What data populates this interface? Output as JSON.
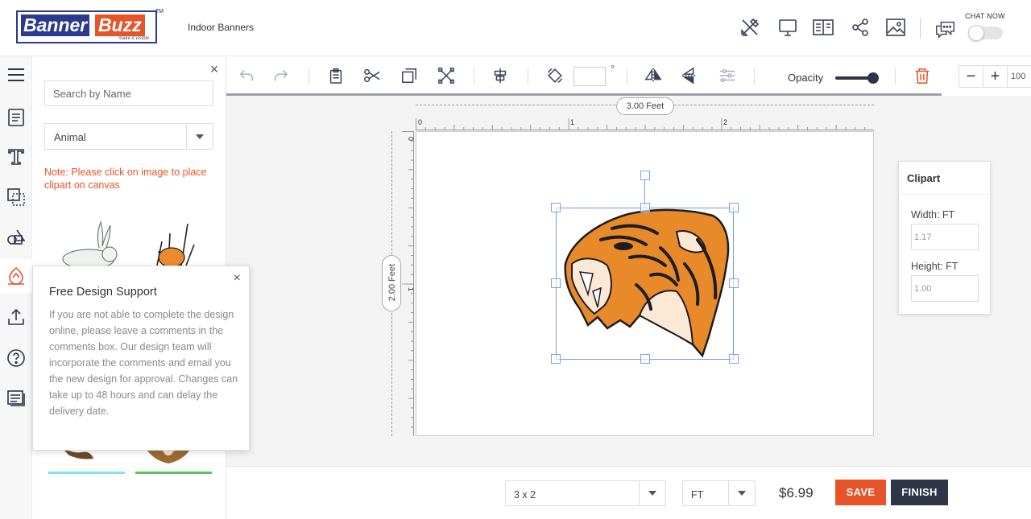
{
  "brand": {
    "logo_part1": "Banner",
    "logo_part2": "Buzz",
    "tagline": "make it visible",
    "trademark": "TM",
    "colors": {
      "navy": "#2a3a8c",
      "orange": "#e8542a",
      "dark": "#2d3547"
    }
  },
  "header": {
    "product_name": "Indoor Banners",
    "icons": [
      "design-tools-icon",
      "monitor-icon",
      "book-icon",
      "share-icon",
      "image-icon",
      "chat-icon"
    ],
    "chat_label": "CHAT NOW",
    "chat_toggle_on": false
  },
  "rail": {
    "items": [
      "menu-icon",
      "template-icon",
      "text-icon",
      "layers-icon",
      "shapes-icon",
      "clipart-icon",
      "upload-icon",
      "help-icon",
      "notes-icon"
    ],
    "active": "clipart-icon"
  },
  "panel": {
    "close": "×",
    "search_placeholder": "Search by Name",
    "category": "Animal",
    "note": "Note: Please click on image to place clipart on canvas"
  },
  "support": {
    "title": "Free Design Support",
    "close": "×",
    "body": "If you are not able to complete the design online, please leave a comments in the comments box. Our design team will incorporate the comments and email you the new design for approval. Changes can take up to 48 hours and can delay the delivery date."
  },
  "toolbar": {
    "degree_symbol": "°",
    "angle_value": "",
    "opacity_label": "Opacity",
    "opacity_value": 1.0,
    "zoom_minus": "−",
    "zoom_plus": "+",
    "zoom_value": "100"
  },
  "canvas": {
    "width_label": "3.00 Feet",
    "height_label": "2.00 Feet",
    "ruler_h": [
      "0",
      "1",
      "2"
    ],
    "ruler_v": [
      "0",
      "1"
    ]
  },
  "clipart_info": {
    "title": "Clipart",
    "width_label": "Width: FT",
    "width_value": "1.17",
    "height_label": "Height: FT",
    "height_value": "1.00"
  },
  "footer": {
    "size": "3 x 2",
    "unit": "FT",
    "price": "$6.99",
    "save": "SAVE",
    "finish": "FINISH"
  }
}
